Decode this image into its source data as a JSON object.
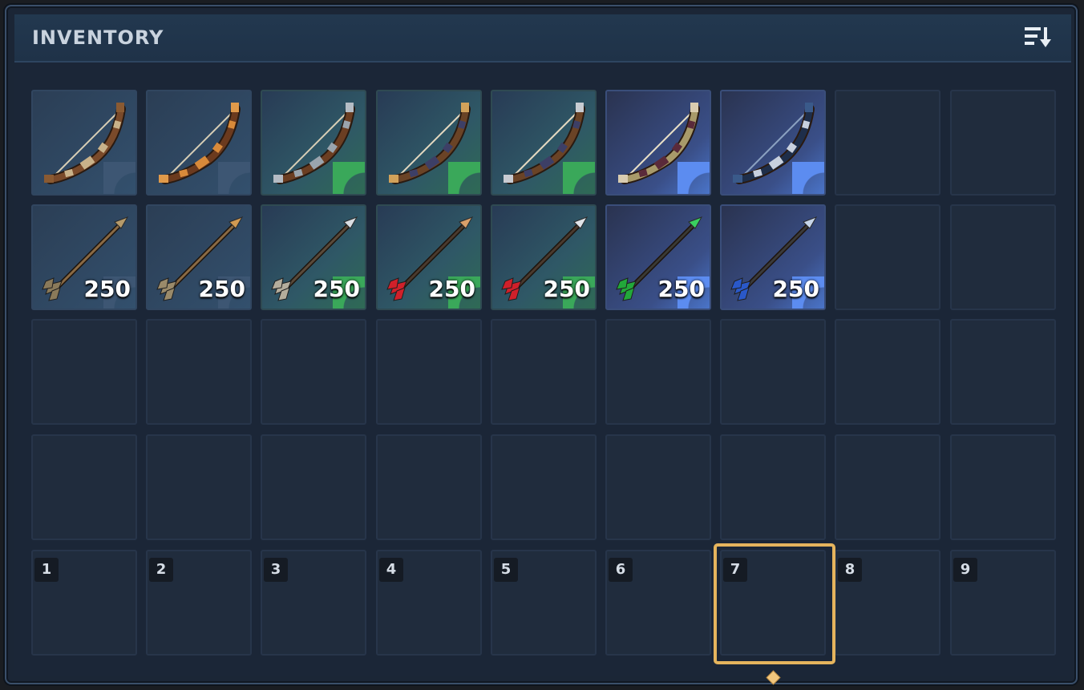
{
  "window": {
    "title": "INVENTORY",
    "sort_icon": "sort-icon"
  },
  "rarity_colors": {
    "common": "#33506d",
    "uncommon": "#3aa85a",
    "rare": "#5c8cf0",
    "selected": "#e5b45d"
  },
  "rows": [
    {
      "slots": [
        {
          "item": "bow",
          "variant": "wooden-bow",
          "rarity": "common"
        },
        {
          "item": "bow",
          "variant": "copper-bow",
          "rarity": "common"
        },
        {
          "item": "bow",
          "variant": "iron-bow",
          "rarity": "uncommon"
        },
        {
          "item": "bow",
          "variant": "gold-tipped-bow",
          "rarity": "uncommon"
        },
        {
          "item": "bow",
          "variant": "silver-tipped-bow",
          "rarity": "uncommon"
        },
        {
          "item": "bow",
          "variant": "bone-bow",
          "rarity": "rare"
        },
        {
          "item": "bow",
          "variant": "dark-blue-bow",
          "rarity": "rare"
        },
        {
          "item": null
        },
        {
          "item": null
        }
      ]
    },
    {
      "slots": [
        {
          "item": "arrow",
          "variant": "wooden-arrow",
          "rarity": "common",
          "quantity": "250"
        },
        {
          "item": "arrow",
          "variant": "copper-arrow",
          "rarity": "common",
          "quantity": "250"
        },
        {
          "item": "arrow",
          "variant": "iron-arrow",
          "rarity": "uncommon",
          "quantity": "250"
        },
        {
          "item": "arrow",
          "variant": "red-fletched-arrow",
          "rarity": "uncommon",
          "quantity": "250"
        },
        {
          "item": "arrow",
          "variant": "red-fletched-steel-arrow",
          "rarity": "uncommon",
          "quantity": "250"
        },
        {
          "item": "arrow",
          "variant": "green-arrow",
          "rarity": "rare",
          "quantity": "250"
        },
        {
          "item": "arrow",
          "variant": "blue-arrow",
          "rarity": "rare",
          "quantity": "250"
        },
        {
          "item": null
        },
        {
          "item": null
        }
      ]
    },
    {
      "slots": [
        {
          "item": null
        },
        {
          "item": null
        },
        {
          "item": null
        },
        {
          "item": null
        },
        {
          "item": null
        },
        {
          "item": null
        },
        {
          "item": null
        },
        {
          "item": null
        },
        {
          "item": null
        }
      ]
    },
    {
      "slots": [
        {
          "item": null
        },
        {
          "item": null
        },
        {
          "item": null
        },
        {
          "item": null
        },
        {
          "item": null
        },
        {
          "item": null
        },
        {
          "item": null
        },
        {
          "item": null
        },
        {
          "item": null
        }
      ]
    }
  ],
  "hotbar": {
    "slots": [
      {
        "key": "1"
      },
      {
        "key": "2"
      },
      {
        "key": "3"
      },
      {
        "key": "4"
      },
      {
        "key": "5"
      },
      {
        "key": "6"
      },
      {
        "key": "7"
      },
      {
        "key": "8"
      },
      {
        "key": "9"
      }
    ],
    "selected_key": "7"
  }
}
